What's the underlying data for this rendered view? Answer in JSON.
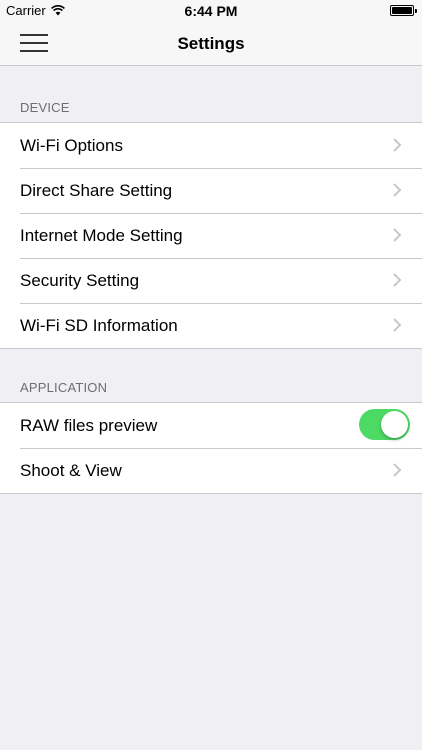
{
  "status_bar": {
    "carrier": "Carrier",
    "time": "6:44 PM"
  },
  "nav": {
    "title": "Settings"
  },
  "sections": {
    "device": {
      "header": "DEVICE",
      "items": [
        {
          "label": "Wi-Fi Options"
        },
        {
          "label": "Direct Share Setting"
        },
        {
          "label": "Internet Mode Setting"
        },
        {
          "label": "Security Setting"
        },
        {
          "label": "Wi-Fi SD Information"
        }
      ]
    },
    "application": {
      "header": "APPLICATION",
      "items": [
        {
          "label": "RAW files preview",
          "toggle": true
        },
        {
          "label": "Shoot & View"
        }
      ]
    }
  },
  "colors": {
    "toggle_on": "#4cd964",
    "background": "#efeff4",
    "separator": "#c8c7cc",
    "chevron": "#c7c7cc"
  }
}
